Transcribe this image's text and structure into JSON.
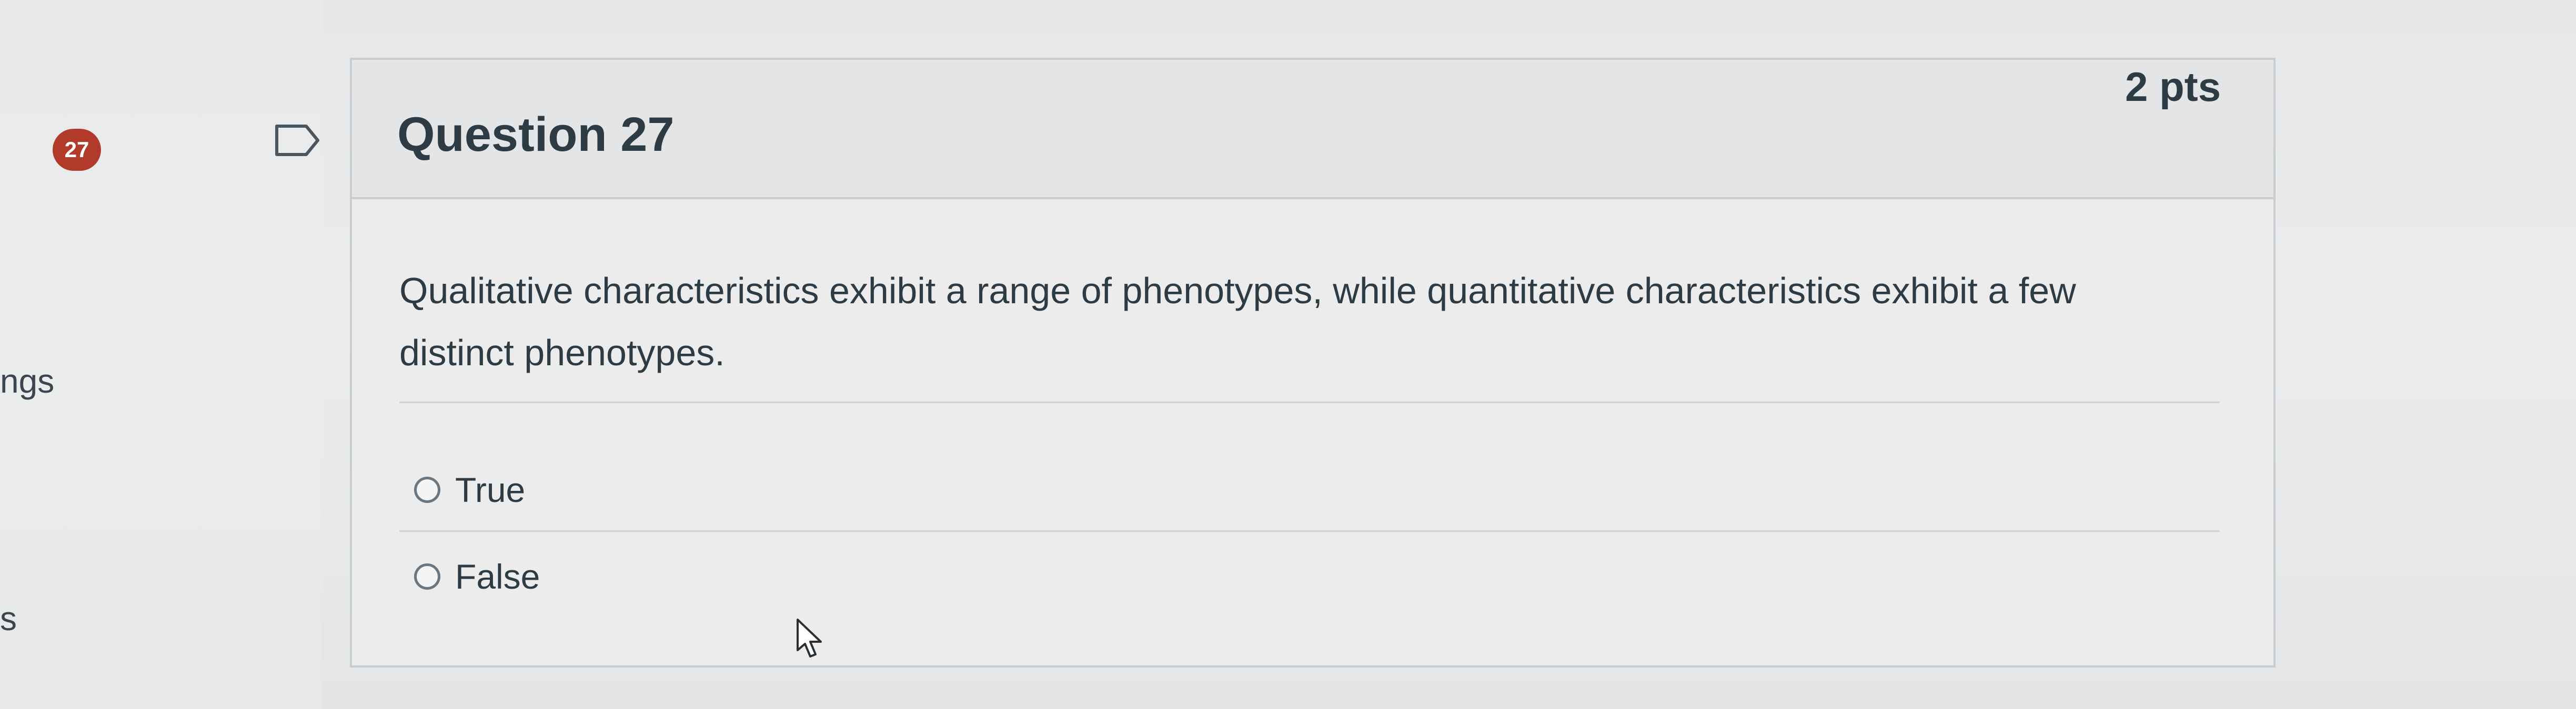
{
  "sidebar": {
    "question_number_badge": "27",
    "partial_text_1": "ngs",
    "partial_text_2": "s"
  },
  "icons": {
    "flag": "flag-outline-icon",
    "cursor": "mouse-pointer-icon"
  },
  "question": {
    "title": "Question 27",
    "points": "2 pts",
    "text": "Qualitative characteristics exhibit a range of phenotypes, while quantitative characteristics exhibit a few distinct phenotypes.",
    "answers": [
      {
        "label": "True",
        "selected": false
      },
      {
        "label": "False",
        "selected": false
      }
    ]
  },
  "colors": {
    "badge": "#b23a2b",
    "text": "#2d3b45",
    "border": "#c7cdd1"
  }
}
